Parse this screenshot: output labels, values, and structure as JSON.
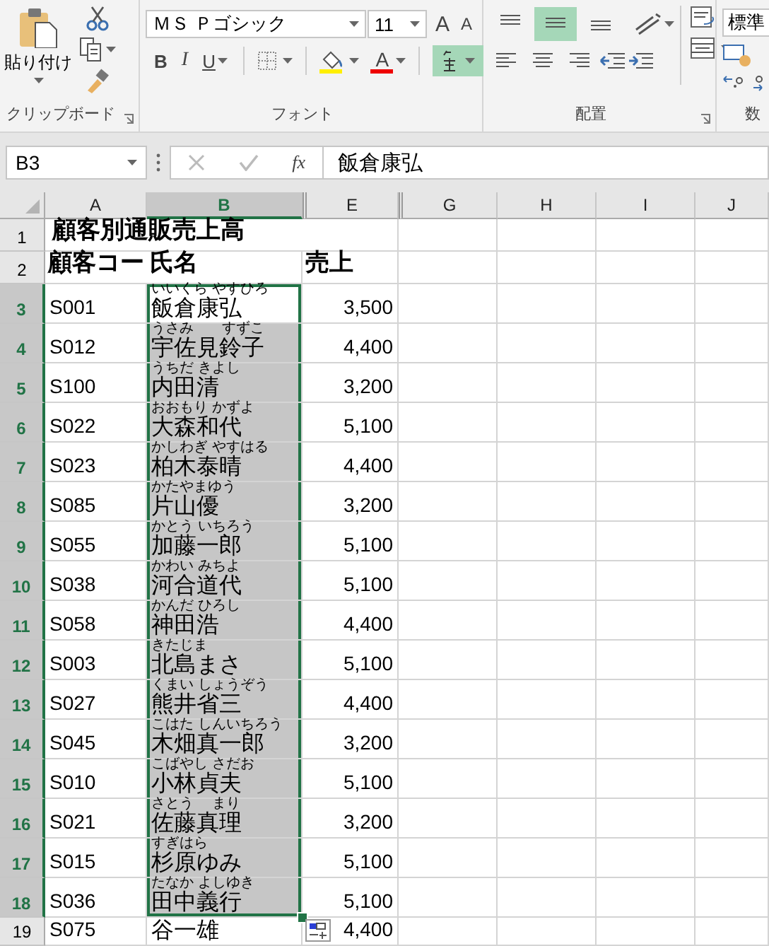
{
  "ribbon": {
    "clipboard": {
      "paste_label": "貼り付け",
      "label": "クリップボード"
    },
    "font": {
      "name": "ＭＳ Ｐゴシック",
      "size": "11",
      "grow_label": "A",
      "shrink_label": "A",
      "bold_label": "B",
      "italic_label": "I",
      "underline_label": "U",
      "font_color_label": "A",
      "phonetic": {
        "selected": true
      },
      "label": "フォント"
    },
    "alignment": {
      "label": "配置",
      "vertical": [
        {
          "kind": "top",
          "selected": false
        },
        {
          "kind": "middle",
          "selected": true
        },
        {
          "kind": "bottom",
          "selected": false
        }
      ],
      "horizontal": [
        {
          "kind": "left",
          "selected": false
        },
        {
          "kind": "center",
          "selected": false
        },
        {
          "kind": "right",
          "selected": false
        }
      ]
    },
    "number": {
      "format": "標準",
      "label": "数"
    }
  },
  "formula_bar": {
    "name_box": "B3",
    "insert_function_label": "fx",
    "formula": "飯倉康弘"
  },
  "columns": [
    {
      "label": "A",
      "selected": false,
      "hidden_before": false
    },
    {
      "label": "B",
      "selected": true,
      "hidden_before": false
    },
    {
      "label": "E",
      "selected": false,
      "hidden_before": true
    },
    {
      "label": "G",
      "selected": false,
      "hidden_before": true
    },
    {
      "label": "H",
      "selected": false,
      "hidden_before": false
    },
    {
      "label": "I",
      "selected": false,
      "hidden_before": false
    },
    {
      "label": "J",
      "selected": false,
      "hidden_before": false
    }
  ],
  "rows": [
    {
      "header": "1",
      "kind": "title",
      "selected": false,
      "title": "顧客別通販売上高"
    },
    {
      "header": "2",
      "kind": "heading",
      "selected": false,
      "code": "顧客コー",
      "name": "氏名",
      "sales": "売上"
    },
    {
      "header": "3",
      "kind": "record",
      "selected": true,
      "active": true,
      "code": "S001",
      "furigana": "いいくら やすひろ",
      "name": "飯倉康弘",
      "sales": "3,500"
    },
    {
      "header": "4",
      "kind": "record",
      "selected": true,
      "active": false,
      "code": "S012",
      "furigana": "うさみ　　すずこ",
      "name": "宇佐見鈴子",
      "sales": "4,400"
    },
    {
      "header": "5",
      "kind": "record",
      "selected": true,
      "active": false,
      "code": "S100",
      "furigana": "うちだ きよし",
      "name": "内田清",
      "sales": "3,200"
    },
    {
      "header": "6",
      "kind": "record",
      "selected": true,
      "active": false,
      "code": "S022",
      "furigana": "おおもり かずよ",
      "name": "大森和代",
      "sales": "5,100"
    },
    {
      "header": "7",
      "kind": "record",
      "selected": true,
      "active": false,
      "code": "S023",
      "furigana": "かしわぎ やすはる",
      "name": "柏木泰晴",
      "sales": "4,400"
    },
    {
      "header": "8",
      "kind": "record",
      "selected": true,
      "active": false,
      "code": "S085",
      "furigana": "かたやまゆう",
      "name": "片山優",
      "sales": "3,200"
    },
    {
      "header": "9",
      "kind": "record",
      "selected": true,
      "active": false,
      "code": "S055",
      "furigana": "かとう いちろう",
      "name": "加藤一郎",
      "sales": "5,100"
    },
    {
      "header": "10",
      "kind": "record",
      "selected": true,
      "active": false,
      "code": "S038",
      "furigana": "かわい みちよ",
      "name": "河合道代",
      "sales": "5,100"
    },
    {
      "header": "11",
      "kind": "record",
      "selected": true,
      "active": false,
      "code": "S058",
      "furigana": "かんだ ひろし",
      "name": "神田浩",
      "sales": "4,400"
    },
    {
      "header": "12",
      "kind": "record",
      "selected": true,
      "active": false,
      "code": "S003",
      "furigana": "きたじま",
      "name": "北島まさ",
      "sales": "5,100"
    },
    {
      "header": "13",
      "kind": "record",
      "selected": true,
      "active": false,
      "code": "S027",
      "furigana": "くまい しょうぞう",
      "name": "熊井省三",
      "sales": "4,400"
    },
    {
      "header": "14",
      "kind": "record",
      "selected": true,
      "active": false,
      "code": "S045",
      "furigana": "こはた しんいちろう",
      "name": "木畑真一郎",
      "sales": "3,200"
    },
    {
      "header": "15",
      "kind": "record",
      "selected": true,
      "active": false,
      "code": "S010",
      "furigana": "こばやし さだお",
      "name": "小林貞夫",
      "sales": "5,100"
    },
    {
      "header": "16",
      "kind": "record",
      "selected": true,
      "active": false,
      "code": "S021",
      "furigana": "さとう　 まり",
      "name": "佐藤真理",
      "sales": "3,200"
    },
    {
      "header": "17",
      "kind": "record",
      "selected": true,
      "active": false,
      "code": "S015",
      "furigana": "すぎはら",
      "name": "杉原ゆみ",
      "sales": "5,100"
    },
    {
      "header": "18",
      "kind": "record",
      "selected": true,
      "active": false,
      "code": "S036",
      "furigana": "たなか よしゆき",
      "name": "田中義行",
      "sales": "5,100"
    },
    {
      "header": "19",
      "kind": "record",
      "selected": false,
      "code": "S075",
      "name": "谷一雄",
      "sales": "4,400",
      "paste_options": true
    }
  ]
}
